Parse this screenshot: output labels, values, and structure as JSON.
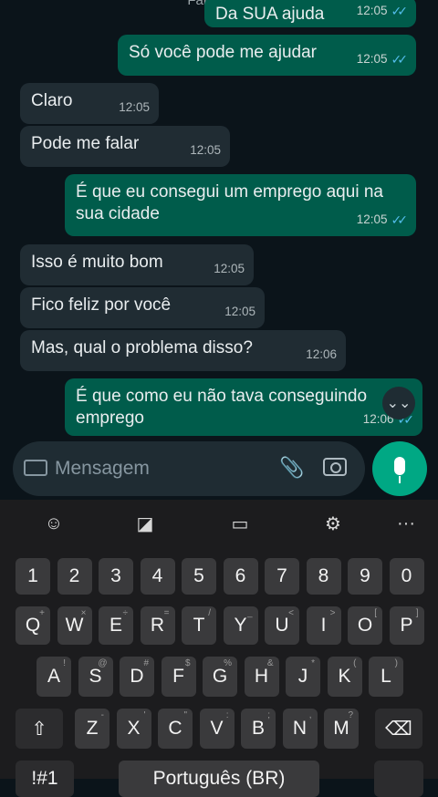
{
  "header": {
    "title": "Fake Chat"
  },
  "messages": [
    {
      "dir": "out",
      "text": "Da SUA ajuda",
      "time": "12:05",
      "ticks": "✓✓"
    },
    {
      "dir": "out",
      "text": "Só você pode me ajudar",
      "time": "12:05",
      "ticks": "✓✓"
    },
    {
      "dir": "in",
      "text": "Claro",
      "time": "12:05"
    },
    {
      "dir": "in",
      "text": "Pode me falar",
      "time": "12:05"
    },
    {
      "dir": "out",
      "text": "É que eu consegui um emprego aqui na sua cidade",
      "time": "12:05",
      "ticks": "✓✓"
    },
    {
      "dir": "in",
      "text": "Isso é muito bom",
      "time": "12:05"
    },
    {
      "dir": "in",
      "text": "Fico feliz por você",
      "time": "12:05"
    },
    {
      "dir": "in",
      "text": "Mas, qual o problema disso?",
      "time": "12:06"
    },
    {
      "dir": "out",
      "text": "É que como eu não tava conseguindo emprego",
      "time": "12:06",
      "ticks": "✓✓"
    }
  ],
  "input": {
    "placeholder": "Mensagem"
  },
  "icons": {
    "scroll_down": "⌄⌄",
    "emoji": "☺",
    "sticker": "◪",
    "clipboard": "▭",
    "settings": "⚙",
    "more": "···",
    "shift": "⇧",
    "backspace": "⌫",
    "attach": "📎"
  },
  "keyboard": {
    "numbers": [
      "1",
      "2",
      "3",
      "4",
      "5",
      "6",
      "7",
      "8",
      "9",
      "0"
    ],
    "row1": [
      [
        "Q",
        "+"
      ],
      [
        "W",
        "×"
      ],
      [
        "E",
        "÷"
      ],
      [
        "R",
        "="
      ],
      [
        "T",
        "/"
      ],
      [
        "Y",
        "_"
      ],
      [
        "U",
        "<"
      ],
      [
        "I",
        ">"
      ],
      [
        "O",
        "["
      ],
      [
        "P",
        "]"
      ]
    ],
    "row2": [
      [
        "A",
        "!"
      ],
      [
        "S",
        "@"
      ],
      [
        "D",
        "#"
      ],
      [
        "F",
        "$"
      ],
      [
        "G",
        "%"
      ],
      [
        "H",
        "&"
      ],
      [
        "J",
        "*"
      ],
      [
        "K",
        "("
      ],
      [
        "L",
        ")"
      ]
    ],
    "row3": [
      [
        "Z",
        "-"
      ],
      [
        "X",
        "'"
      ],
      [
        "C",
        "\""
      ],
      [
        "V",
        ":"
      ],
      [
        "B",
        ";"
      ],
      [
        "N",
        ","
      ],
      [
        "M",
        "?"
      ]
    ],
    "bottom": {
      "symbols": "!#1",
      "space": "Português (BR)"
    }
  }
}
